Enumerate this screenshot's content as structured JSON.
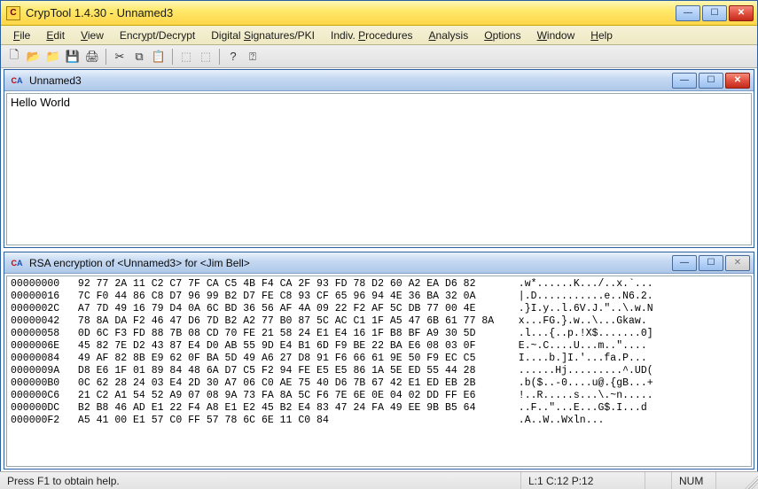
{
  "window": {
    "title": "CrypTool 1.4.30 - Unnamed3",
    "app_icon_text": "C"
  },
  "menu": {
    "items": [
      "File",
      "Edit",
      "View",
      "Encrypt/Decrypt",
      "Digital Signatures/PKI",
      "Indiv. Procedures",
      "Analysis",
      "Options",
      "Window",
      "Help"
    ],
    "underline_index": [
      0,
      0,
      0,
      4,
      8,
      7,
      0,
      0,
      0,
      0
    ]
  },
  "toolbar": {
    "buttons": [
      {
        "name": "new",
        "glyph": "🗋",
        "enabled": true
      },
      {
        "name": "open",
        "glyph": "📂",
        "enabled": true
      },
      {
        "name": "open2",
        "glyph": "📁",
        "enabled": true
      },
      {
        "name": "save",
        "glyph": "💾",
        "enabled": true
      },
      {
        "name": "print",
        "glyph": "🖨",
        "enabled": true
      },
      {
        "name": "sep"
      },
      {
        "name": "cut",
        "glyph": "✂",
        "enabled": true
      },
      {
        "name": "copy",
        "glyph": "⧉",
        "enabled": true
      },
      {
        "name": "paste",
        "glyph": "📋",
        "enabled": true
      },
      {
        "name": "sep"
      },
      {
        "name": "link1",
        "glyph": "⬚",
        "enabled": false
      },
      {
        "name": "link2",
        "glyph": "⬚",
        "enabled": false
      },
      {
        "name": "sep"
      },
      {
        "name": "help",
        "glyph": "?",
        "enabled": true
      },
      {
        "name": "whats-this",
        "glyph": "⍰",
        "enabled": true
      }
    ]
  },
  "children": [
    {
      "title": "Unnamed3",
      "content": "Hello World",
      "buttons": [
        "min",
        "max",
        "close"
      ],
      "close_active": true
    },
    {
      "title": "RSA encryption of <Unnamed3> for <Jim Bell>",
      "buttons": [
        "min",
        "max",
        "close"
      ],
      "close_active": false,
      "hex_rows": [
        {
          "off": "00000000",
          "hex": "92 77 2A 11 C2 C7 7F CA C5 4B F4 CA 2F 93 FD 78 D2 60 A2 EA D6 82",
          "asc": ".w*......K.../..x.`..."
        },
        {
          "off": "00000016",
          "hex": "7C F0 44 86 C8 D7 96 99 B2 D7 FE C8 93 CF 65 96 94 4E 36 BA 32 0A",
          "asc": "|.D...........e..N6.2."
        },
        {
          "off": "0000002C",
          "hex": "A7 7D 49 16 79 D4 0A 6C BD 36 56 AF 4A 09 22 F2 AF 5C DB 77 00 4E",
          "asc": ".}I.y..l.6V.J.\"..\\.w.N"
        },
        {
          "off": "00000042",
          "hex": "78 8A DA F2 46 47 D6 7D B2 A2 77 B0 87 5C AC C1 1F A5 47 6B 61 77 8A",
          "asc": "x...FG.}.w..\\...Gkaw."
        },
        {
          "off": "00000058",
          "hex": "0D 6C F3 FD 88 7B 08 CD 70 FE 21 58 24 E1 E4 16 1F B8 BF A9 30 5D",
          "asc": ".l...{..p.!X$.......0]"
        },
        {
          "off": "0000006E",
          "hex": "45 82 7E D2 43 87 E4 D0 AB 55 9D E4 B1 6D F9 BE 22 BA E6 08 03 0F",
          "asc": "E.~.C....U...m..\"...."
        },
        {
          "off": "00000084",
          "hex": "49 AF 82 8B E9 62 0F BA 5D 49 A6 27 D8 91 F6 66 61 9E 50 F9 EC C5",
          "asc": "I....b.]I.'...fa.P..."
        },
        {
          "off": "0000009A",
          "hex": "D8 E6 1F 01 89 84 48 6A D7 C5 F2 94 FE E5 E5 86 1A 5E ED 55 44 28",
          "asc": "......Hj.........^.UD("
        },
        {
          "off": "000000B0",
          "hex": "0C 62 28 24 03 E4 2D 30 A7 06 C0 AE 75 40 D6 7B 67 42 E1 ED EB 2B",
          "asc": ".b($..-0....u@.{gB...+"
        },
        {
          "off": "000000C6",
          "hex": "21 C2 A1 54 52 A9 07 08 9A 73 FA 8A 5C F6 7E 6E 0E 04 02 DD FF E6",
          "asc": "!..R.....s...\\.~n....."
        },
        {
          "off": "000000DC",
          "hex": "B2 B8 46 AD E1 22 F4 A8 E1 E2 45 B2 E4 83 47 24 FA 49 EE 9B B5 64",
          "asc": "..F..\"...E...G$.I...d"
        },
        {
          "off": "000000F2",
          "hex": "A5 41 00 E1 57 C0 FF 57 78 6C 6E 11 C0 84",
          "asc": ".A..W..Wxln..."
        }
      ]
    }
  ],
  "statusbar": {
    "hint": "Press F1 to obtain help.",
    "pos": "L:1  C:12  P:12",
    "num": "NUM"
  }
}
